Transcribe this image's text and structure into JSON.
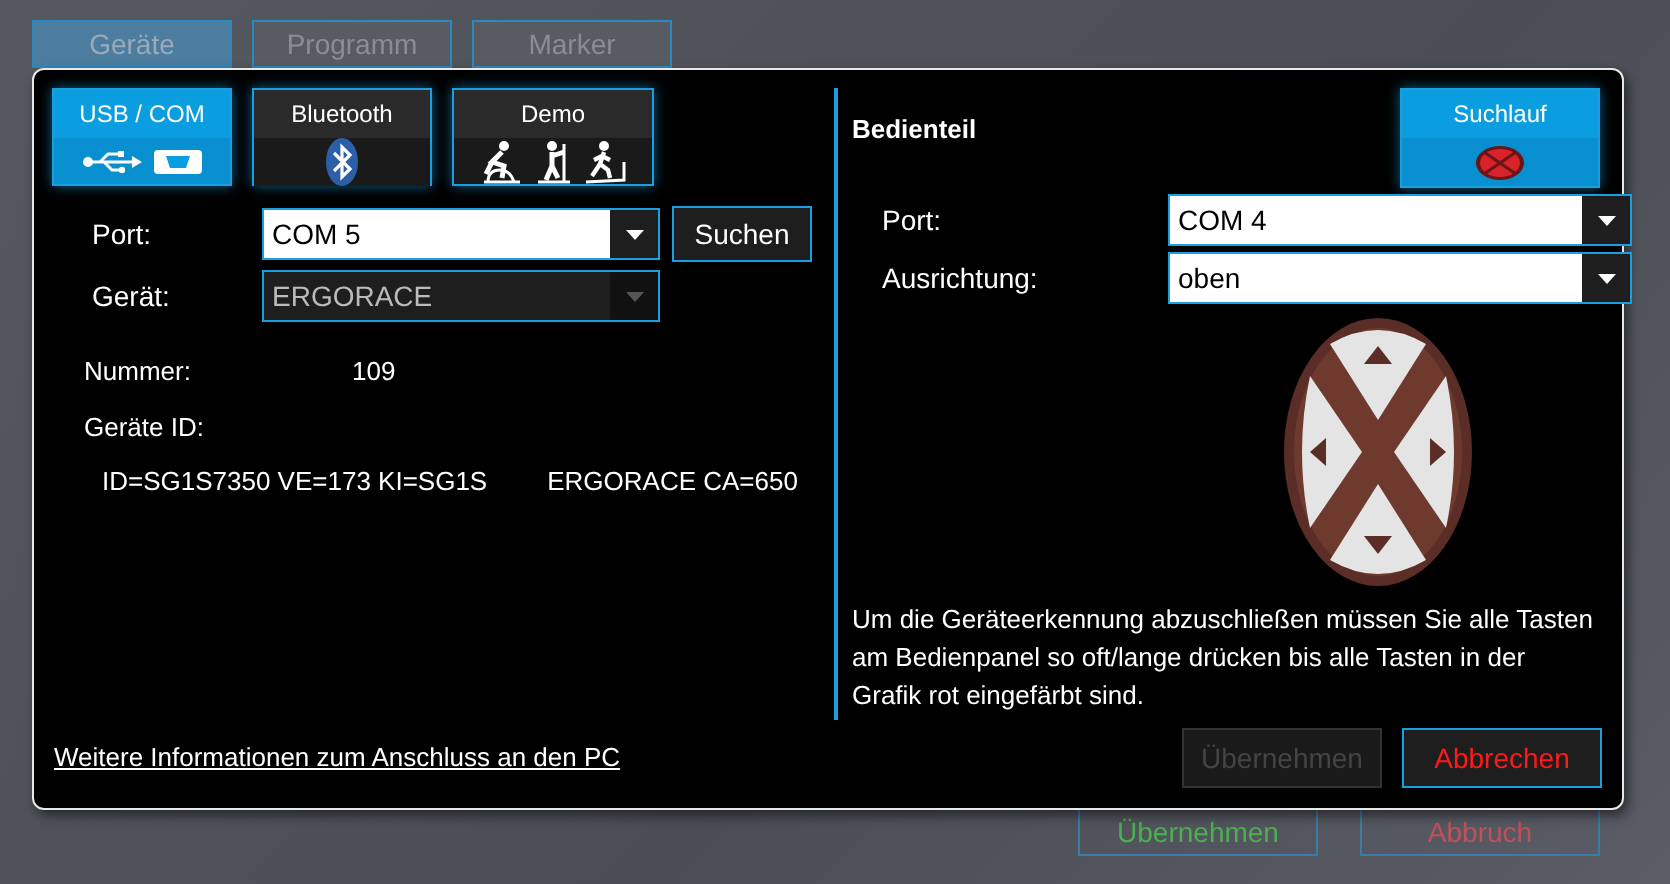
{
  "background_tabs": [
    {
      "label": "Geräte",
      "selected": true
    },
    {
      "label": "Programm",
      "selected": false
    },
    {
      "label": "Marker",
      "selected": false
    }
  ],
  "dialog": {
    "connection_tabs": [
      {
        "label": "USB / COM",
        "kind": "usb",
        "selected": true
      },
      {
        "label": "Bluetooth",
        "kind": "bluetooth",
        "selected": false
      },
      {
        "label": "Demo",
        "kind": "demo",
        "selected": false
      }
    ],
    "port": {
      "label": "Port:",
      "value": "COM 5"
    },
    "search_button": "Suchen",
    "device": {
      "label": "Gerät:",
      "value": "ERGORACE",
      "disabled": true
    },
    "number": {
      "label": "Nummer:",
      "value": "109"
    },
    "device_id": {
      "label": "Geräte ID:",
      "id_text": "ID=SG1S7350 VE=173 KI=SG1S",
      "device_text": "ERGORACE CA=650"
    },
    "info_link": "Weitere Informationen zum Anschluss an den PC",
    "panel": {
      "title": "Bedienteil",
      "scan_button": "Suchlauf",
      "port": {
        "label": "Port:",
        "value": "COM 4"
      },
      "orientation": {
        "label": "Ausrichtung:",
        "value": "oben"
      },
      "instruction": "Um die Geräteerkennung abzuschließen müssen Sie alle Tasten am Bedienpanel so oft/lange drücken bis alle Tasten in der Grafik rot eingefärbt sind."
    },
    "buttons": [
      {
        "label": "Übernehmen",
        "kind": "apply",
        "disabled": true
      },
      {
        "label": "Abbrechen",
        "kind": "cancel",
        "disabled": false
      }
    ]
  },
  "background_buttons": [
    {
      "label": "Übernehmen",
      "kind": "apply"
    },
    {
      "label": "Abbruch",
      "kind": "cancel"
    }
  ]
}
